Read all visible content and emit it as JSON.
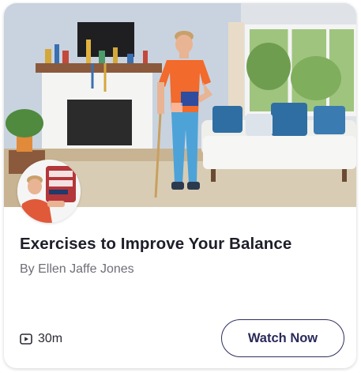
{
  "course": {
    "title": "Exercises to Improve Your Balance",
    "author": "By Ellen Jaffe Jones",
    "duration": "30m",
    "duration_icon": "play-icon",
    "cta_label": "Watch Now"
  },
  "colors": {
    "title": "#1e1e2a",
    "author": "#6e6e78",
    "button_border": "#2f2f5f"
  }
}
